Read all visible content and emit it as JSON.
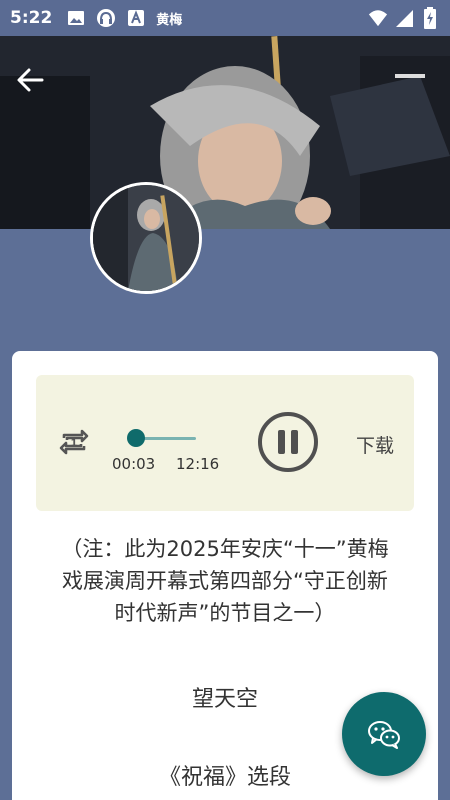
{
  "status_bar": {
    "time": "5:22",
    "app_label": "黄梅",
    "icons": [
      "image-icon",
      "headset-icon",
      "text-a-icon",
      "wifi-icon",
      "signal-icon",
      "battery-charging-icon"
    ]
  },
  "header": {
    "back_icon": "arrow-left-icon",
    "hero_image": "opera-performer-photo",
    "avatar_image": "opera-performer-thumbnail"
  },
  "player": {
    "repeat_icon": "repeat-one-icon",
    "current_time": "00:03",
    "total_time": "12:16",
    "progress": 0.004,
    "state_icon": "pause-icon",
    "download_label": "下载"
  },
  "content": {
    "note_line1": "（注：此为2025年安庆“十一”黄梅",
    "note_line2": "戏展演周开幕式第四部分“守正创新",
    "note_line3": "时代新声”的节目之一）",
    "title": "望天空",
    "subtitle": "《祝福》选段"
  },
  "fab": {
    "icon": "wechat-icon"
  },
  "colors": {
    "header_bg": "#5d6f96",
    "player_bg": "#f3f3e1",
    "accent": "#0f6b6b"
  }
}
